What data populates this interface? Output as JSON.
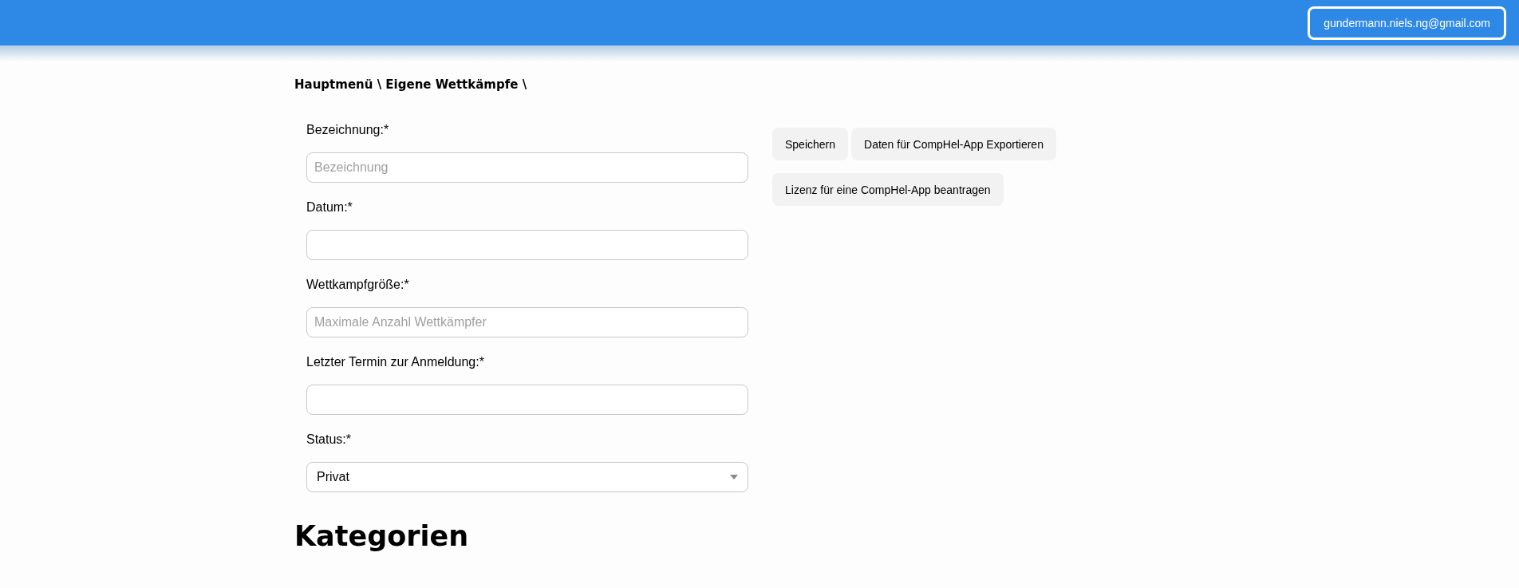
{
  "header": {
    "user_email": "gundermann.niels.ng@gmail.com"
  },
  "breadcrumb": "Hauptmenü \\ Eigene Wettkämpfe \\",
  "form": {
    "fields": [
      {
        "kind": "text",
        "label": "Bezeichnung:*",
        "placeholder": "Bezeichnung"
      },
      {
        "kind": "text",
        "label": "Datum:*"
      },
      {
        "kind": "text",
        "label": "Wettkampfgröße:*",
        "placeholder": "Maximale Anzahl Wettkämpfer"
      },
      {
        "kind": "text",
        "label": "Letzter Termin zur Anmeldung:*"
      },
      {
        "kind": "select",
        "label": "Status:*",
        "value": "Privat"
      }
    ]
  },
  "actions": [
    [
      "Speichern",
      "Daten für CompHel-App Exportieren"
    ],
    [
      "Lizenz für eine CompHel-App beantragen"
    ]
  ],
  "section_heading": "Kategorien"
}
